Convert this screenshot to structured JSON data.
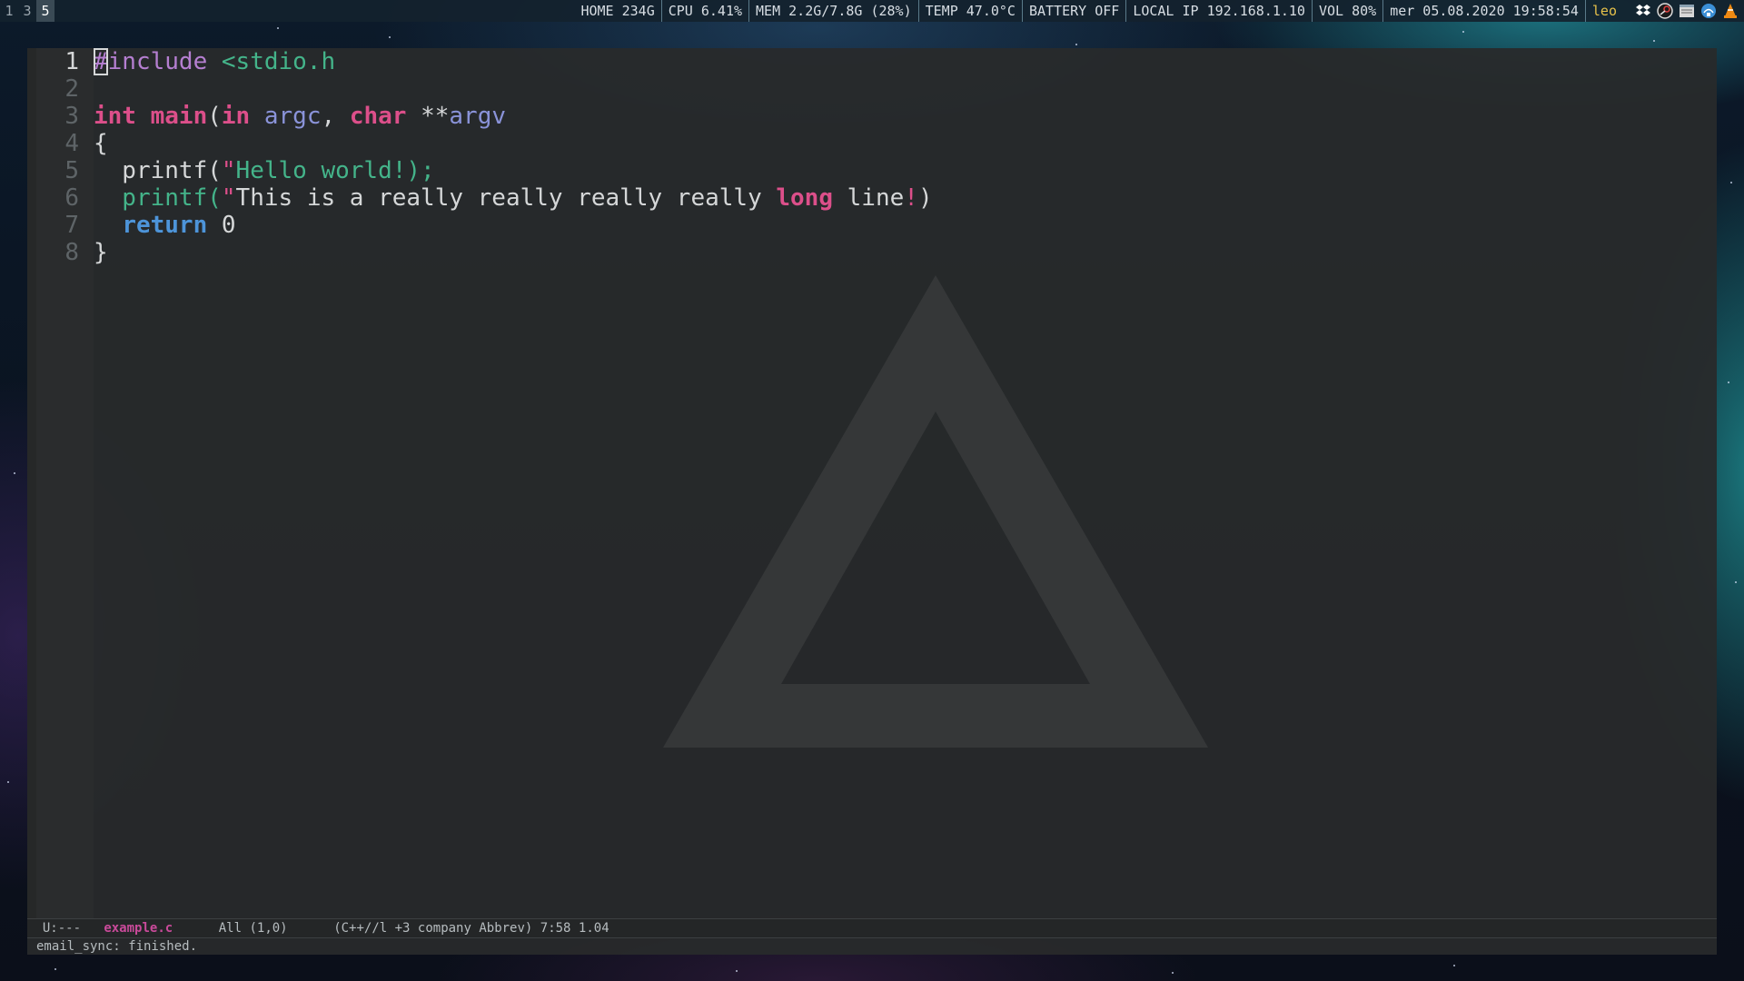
{
  "topbar": {
    "workspaces": [
      "1",
      "3",
      "5"
    ],
    "active_workspace": "5",
    "status": {
      "home": "HOME 234G",
      "cpu": "CPU 6.41%",
      "mem": "MEM 2.2G/7.8G (28%)",
      "temp": "TEMP 47.0°C",
      "battery": "BATTERY OFF",
      "ip": "LOCAL IP 192.168.1.10",
      "vol": "VOL 80%",
      "datetime": "mer 05.08.2020 19:58:54",
      "user": "leo"
    },
    "tray_icons": [
      "dropbox-icon",
      "steam-icon",
      "window-list-icon",
      "network-icon",
      "vlc-icon"
    ]
  },
  "editor": {
    "line_numbers": [
      "1",
      "2",
      "3",
      "4",
      "5",
      "6",
      "7",
      "8"
    ],
    "current_line": "1",
    "lines": {
      "l1": {
        "hash": "#",
        "include": "include",
        "header": " <stdio.h"
      },
      "l3": {
        "int": "int",
        "main": "main",
        "paren": "(",
        "in": "in",
        "argc": "argc",
        "comma": ", ",
        "char": "char",
        "stars": " **",
        "argv": "argv"
      },
      "l4": {
        "brace": "{"
      },
      "l5": {
        "call": "  printf(",
        "quote": "\"",
        "str": "Hello world!);"
      },
      "l6": {
        "call": "  printf(",
        "quote": "\"",
        "str1": "This is a really really really really ",
        "long": "long",
        "str2": " line",
        "bang": "!",
        "close": ")"
      },
      "l7": {
        "ret": "return",
        "val": " 0"
      },
      "l8": {
        "brace": "}"
      }
    }
  },
  "modeline": {
    "state": "U:---",
    "buffer": "example.c",
    "position": "All (1,0)",
    "modes": "(C++//l +3 company Abbrev) 7:58 1.04"
  },
  "echo_area": "email_sync: finished."
}
